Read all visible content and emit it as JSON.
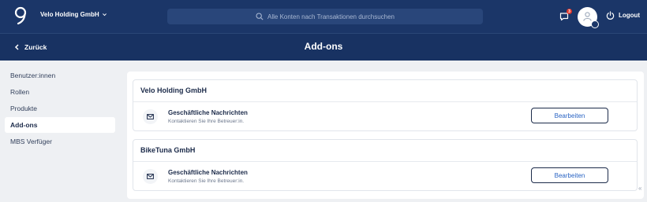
{
  "header": {
    "company_name": "Velo Holding GmbH",
    "search_placeholder": "Alle Konten nach Transaktionen durchsuchen",
    "notification_count": "3",
    "logout_label": "Logout"
  },
  "subheader": {
    "back_label": "Zurück",
    "page_title": "Add-ons"
  },
  "sidebar": {
    "items": [
      {
        "label": "Benutzer:innen"
      },
      {
        "label": "Rollen"
      },
      {
        "label": "Produkte"
      },
      {
        "label": "Add-ons"
      },
      {
        "label": "MBS Verfüger"
      }
    ]
  },
  "sections": [
    {
      "title": "Velo Holding GmbH",
      "addon_title": "Geschäftliche Nachrichten",
      "addon_subtitle": "Kontaktieren Sie Ihre Betreuer:in.",
      "button_label": "Bearbeiten"
    },
    {
      "title": "BikeTuna GmbH",
      "addon_title": "Geschäftliche Nachrichten",
      "addon_subtitle": "Kontaktieren Sie Ihre Betreuer:in.",
      "button_label": "Bearbeiten"
    }
  ],
  "collapse_glyph": "«"
}
